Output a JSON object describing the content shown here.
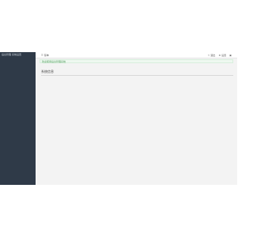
{
  "sidebar": {
    "title": "后台管理  系统设置"
  },
  "topbar": {
    "menu_label": "菜单",
    "actions": [
      {
        "label": "退出"
      },
      {
        "label": "设置"
      },
      {
        "label": ""
      }
    ]
  },
  "notice": {
    "text": "欢迎使用后台管理系统"
  },
  "main": {
    "section_title": "系统信息"
  },
  "colors": {
    "sidebar_bg": "#2f3a48",
    "notice_bg": "#eef8f0",
    "notice_text": "#4f9a5b"
  }
}
